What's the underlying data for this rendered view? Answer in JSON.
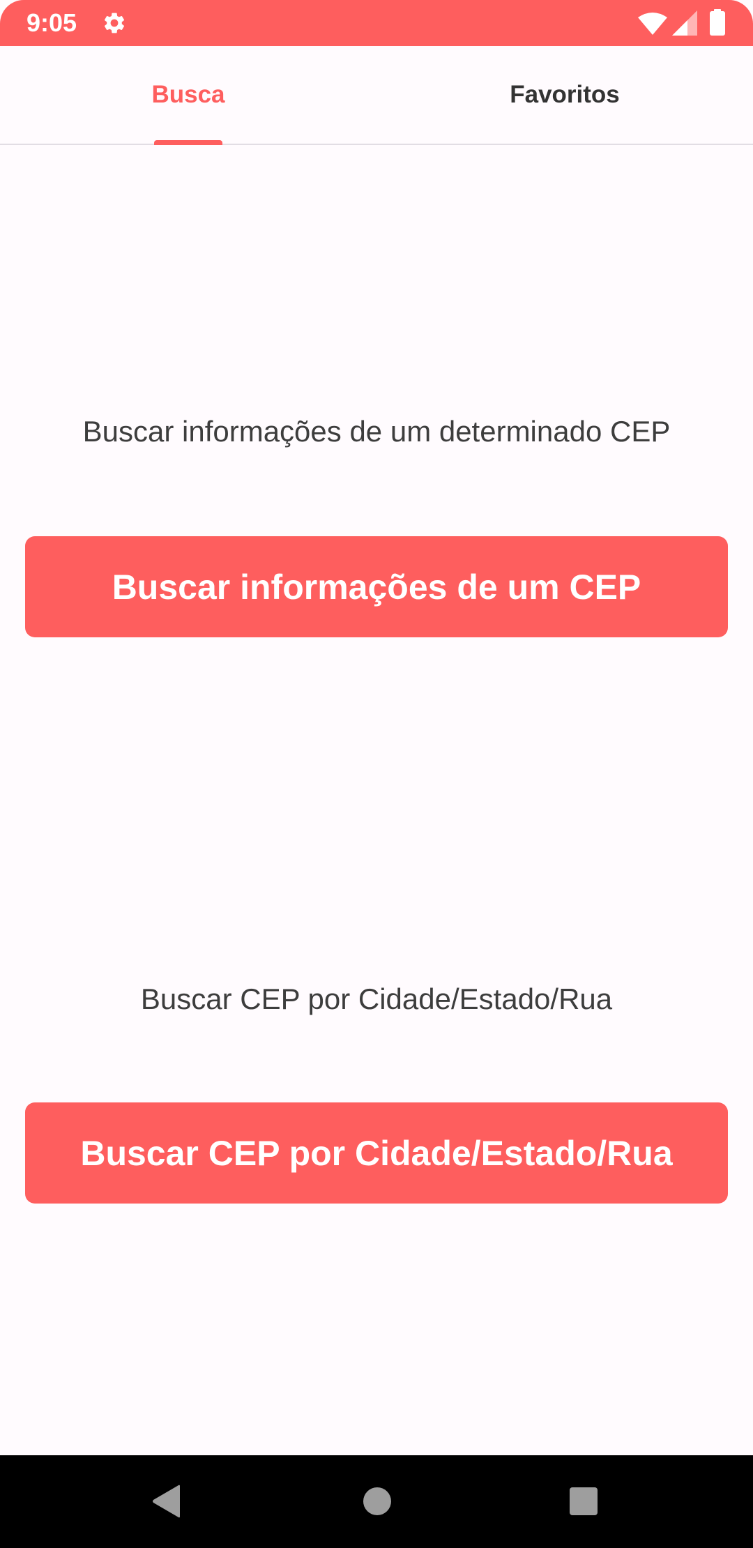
{
  "status_bar": {
    "time": "9:05",
    "icons": [
      "gear-icon",
      "wifi-icon",
      "signal-icon",
      "battery-icon"
    ],
    "background_color": "#fe5e5e"
  },
  "tabs": [
    {
      "label": "Busca",
      "selected": true
    },
    {
      "label": "Favoritos",
      "selected": false
    }
  ],
  "main": {
    "cep_description": "Buscar informações de um determinado CEP",
    "cep_button_label": "Buscar informações de um CEP",
    "city_description": "Buscar CEP por Cidade/Estado/Rua",
    "city_button_label": "Buscar CEP por Cidade/Estado/Rua"
  },
  "navigation_bar": {
    "icons": [
      "back-icon",
      "home-icon",
      "recents-icon"
    ]
  },
  "colors": {
    "accent": "#fe5e5e",
    "background": "#fffbfe",
    "text": "#3d3d3d"
  }
}
